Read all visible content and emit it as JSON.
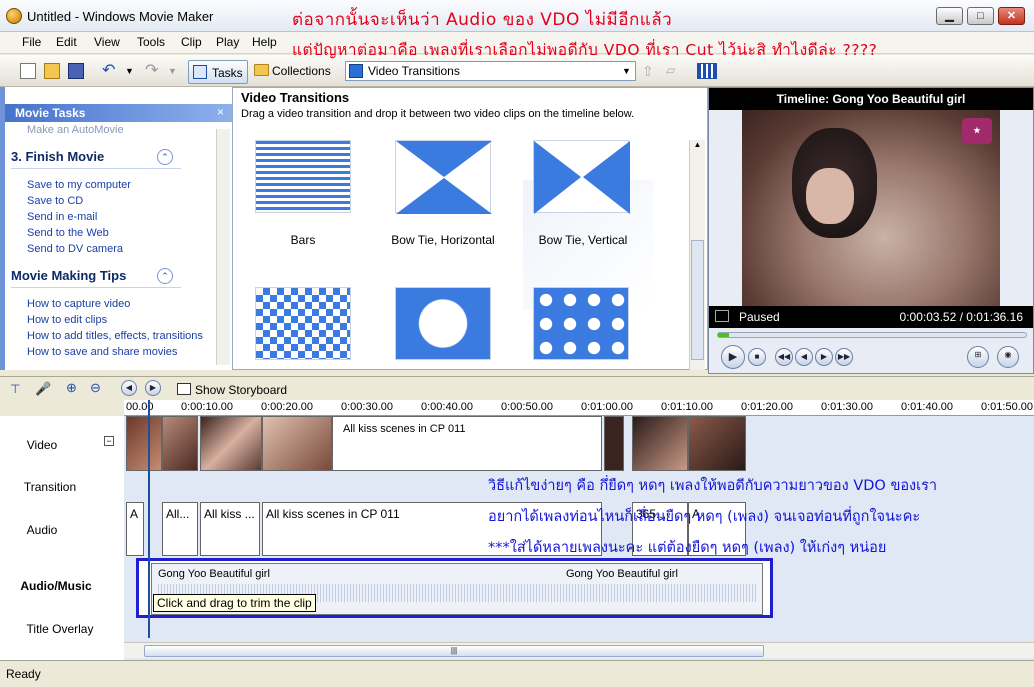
{
  "window": {
    "title": "Untitled - Windows Movie Maker",
    "min": "▁",
    "max": "□",
    "close": "✕"
  },
  "menu": [
    "File",
    "Edit",
    "View",
    "Tools",
    "Clip",
    "Play",
    "Help"
  ],
  "toolbar": {
    "tasks_label": "Tasks",
    "collections_label": "Collections",
    "view_select": "Video Transitions"
  },
  "annotations": {
    "line1": "ต่อจากนั้นจะเห็นว่า Audio ของ VDO ไม่มีอีกแล้ว",
    "line2": "แต่ปัญหาต่อมาคือ เพลงที่เราเลือกไม่พอดีกับ VDO ที่เรา Cut ไว้น่ะสิ ทำไงดีล่ะ ????",
    "line3": "วิธีแก้ไขง่ายๆ คือ กึ่ยืดๆ หดๆ เพลงให้พอดีกับความยาวของ VDO ของเรา",
    "line4": "อยากได้เพลงท่อนไหนก็เลื่อนยืดๆ หดๆ (เพลง) จนเจอท่อนที่ถูกใจนะคะ",
    "line5": "***ใส่ได้หลายเพลงนะคะ แต่ต้องยืดๆ หดๆ (เพลง) ให้เก่งๆ หน่อย"
  },
  "taskpane": {
    "title": "Movie Tasks",
    "close": "×",
    "make_automovie": "Make an AutoMovie",
    "finish_heading": "3. Finish Movie",
    "finish_links": [
      "Save to my computer",
      "Save to CD",
      "Send in e-mail",
      "Send to the Web",
      "Send to DV camera"
    ],
    "tips_heading": "Movie Making Tips",
    "tips_links": [
      "How to capture video",
      "How to edit clips",
      "How to add titles, effects, transitions",
      "How to save and share movies"
    ]
  },
  "transitions": {
    "title": "Video Transitions",
    "description": "Drag a video transition and drop it between two video clips on the timeline below.",
    "items": [
      "Bars",
      "Bow Tie, Horizontal",
      "Bow Tie, Vertical"
    ]
  },
  "preview": {
    "title": "Timeline: Gong Yoo Beautiful girl",
    "status": "Paused",
    "time": "0:00:03.52 / 0:01:36.16",
    "progress": 0.037
  },
  "timeline": {
    "show_storyboard": "Show Storyboard",
    "ticks": [
      "00.00",
      "0:00:10.00",
      "0:00:20.00",
      "0:00:30.00",
      "0:00:40.00",
      "0:00:50.00",
      "0:01:00.00",
      "0:01:10.00",
      "0:01:20.00",
      "0:01:30.00",
      "0:01:40.00",
      "0:01:50.00"
    ],
    "tracks": [
      "Video",
      "Transition",
      "Audio",
      "Audio/Music",
      "Title Overlay"
    ],
    "video_clip_label": "All kiss scenes in CP 011",
    "audio_clips": [
      "A",
      "All...",
      "All kiss ...",
      "All kiss scenes in CP 011",
      "365...",
      "A"
    ],
    "music_clip_1": "Gong Yoo Beautiful girl",
    "music_clip_2": "Gong Yoo Beautiful girl",
    "tooltip": "Click and drag to trim the clip"
  },
  "status": "Ready"
}
